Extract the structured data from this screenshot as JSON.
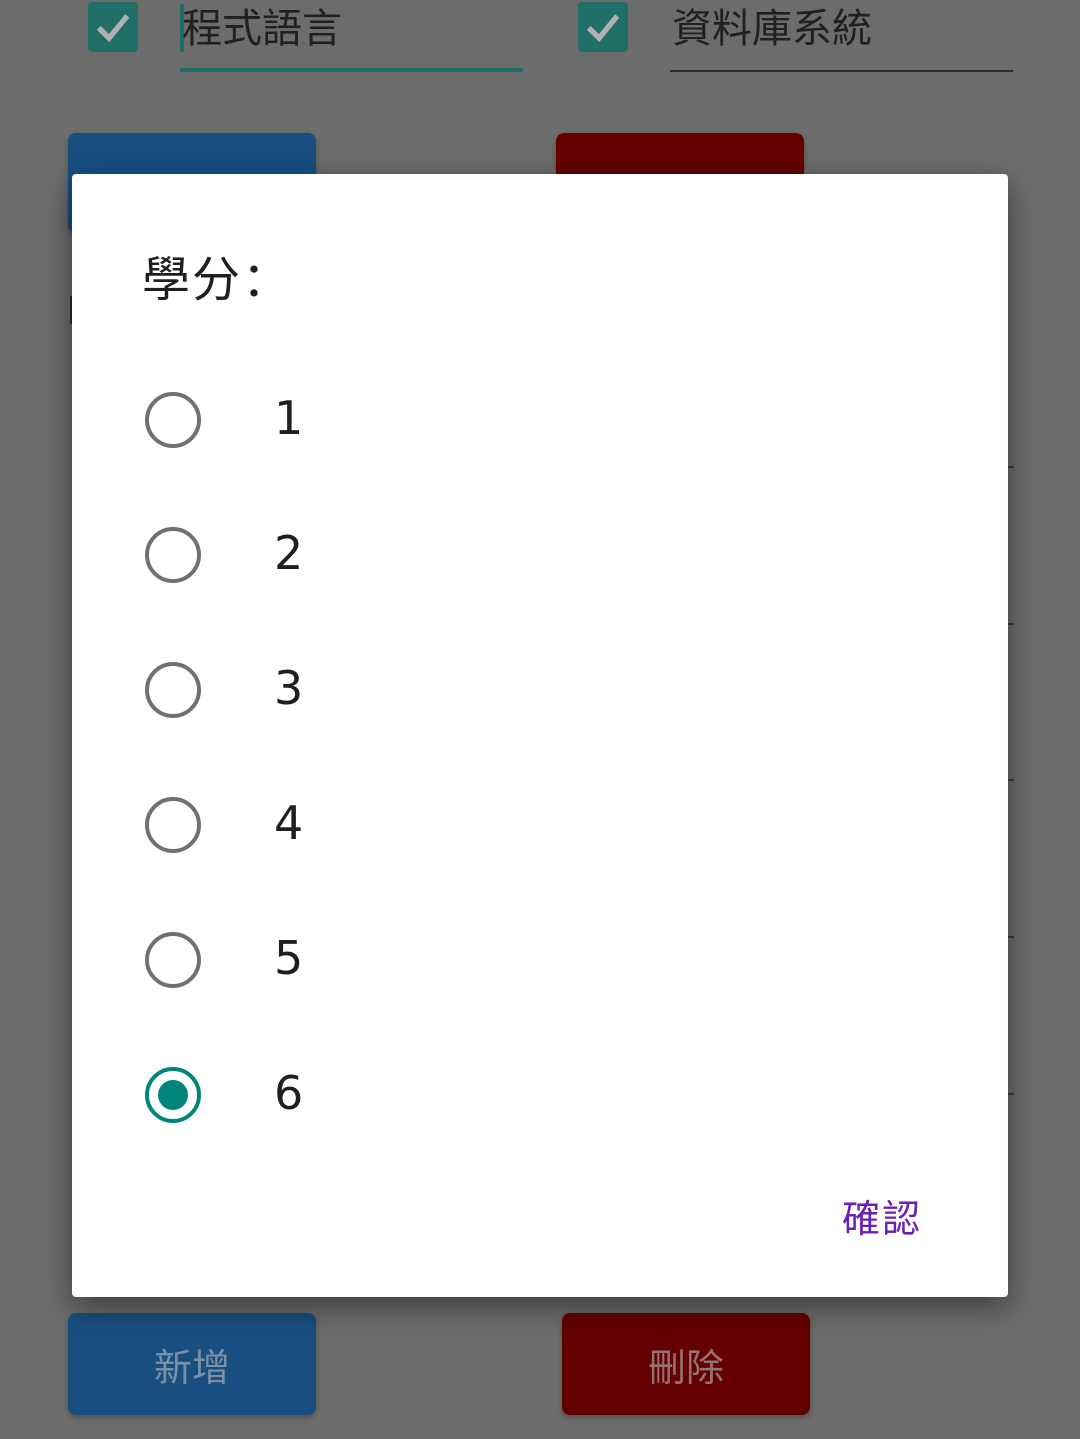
{
  "background": {
    "courses": [
      {
        "label": "程式語言",
        "checked": true
      },
      {
        "label": "資料庫系統",
        "checked": true
      }
    ],
    "add_button": "新增",
    "delete_button": "刪除"
  },
  "dialog": {
    "title": "學分：",
    "options": [
      {
        "label": "1",
        "selected": false
      },
      {
        "label": "2",
        "selected": false
      },
      {
        "label": "3",
        "selected": false
      },
      {
        "label": "4",
        "selected": false
      },
      {
        "label": "5",
        "selected": false
      },
      {
        "label": "6",
        "selected": true
      }
    ],
    "confirm_label": "確認"
  },
  "colors": {
    "accent": "#00857a",
    "confirm_text": "#6a1fb6",
    "add_button": "#184f80",
    "delete_button": "#640000"
  },
  "icons": {
    "checkbox": "checkmark-icon"
  }
}
